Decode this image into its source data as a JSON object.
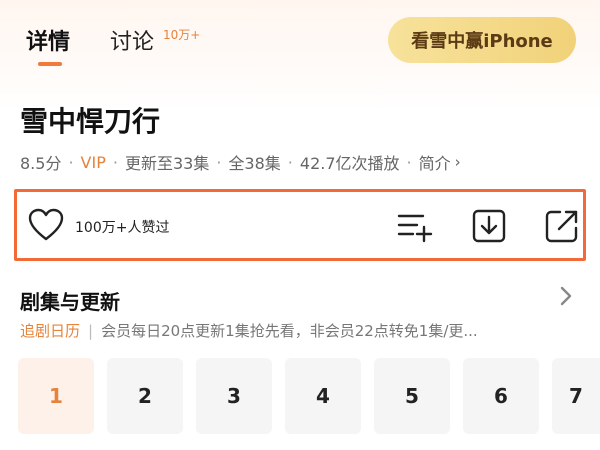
{
  "tabs": [
    {
      "label": "详情"
    },
    {
      "label": "讨论",
      "badge": "10万+"
    }
  ],
  "promo": {
    "label": "看雪中赢iPhone"
  },
  "show": {
    "title": "雪中悍刀行",
    "rating": "8.5分",
    "vip": "VIP",
    "update": "更新至33集",
    "total": "全38集",
    "plays": "42.7亿次播放",
    "intro": "简介"
  },
  "actions": {
    "likes": "100万+人赞过",
    "icons": [
      "heart-icon",
      "add-to-playlist-icon",
      "download-icon",
      "share-icon"
    ],
    "highlight_color": "#f26a38"
  },
  "episodes_section": {
    "title": "剧集与更新",
    "calendar": "追剧日历",
    "notice": "会员每日20点更新1集抢先看，非会员22点转免1集/更..."
  },
  "episodes": [
    "1",
    "2",
    "3",
    "4",
    "5",
    "6",
    "7"
  ],
  "colors": {
    "accent": "#e5833b",
    "promo_gold": "#f1d27a"
  }
}
